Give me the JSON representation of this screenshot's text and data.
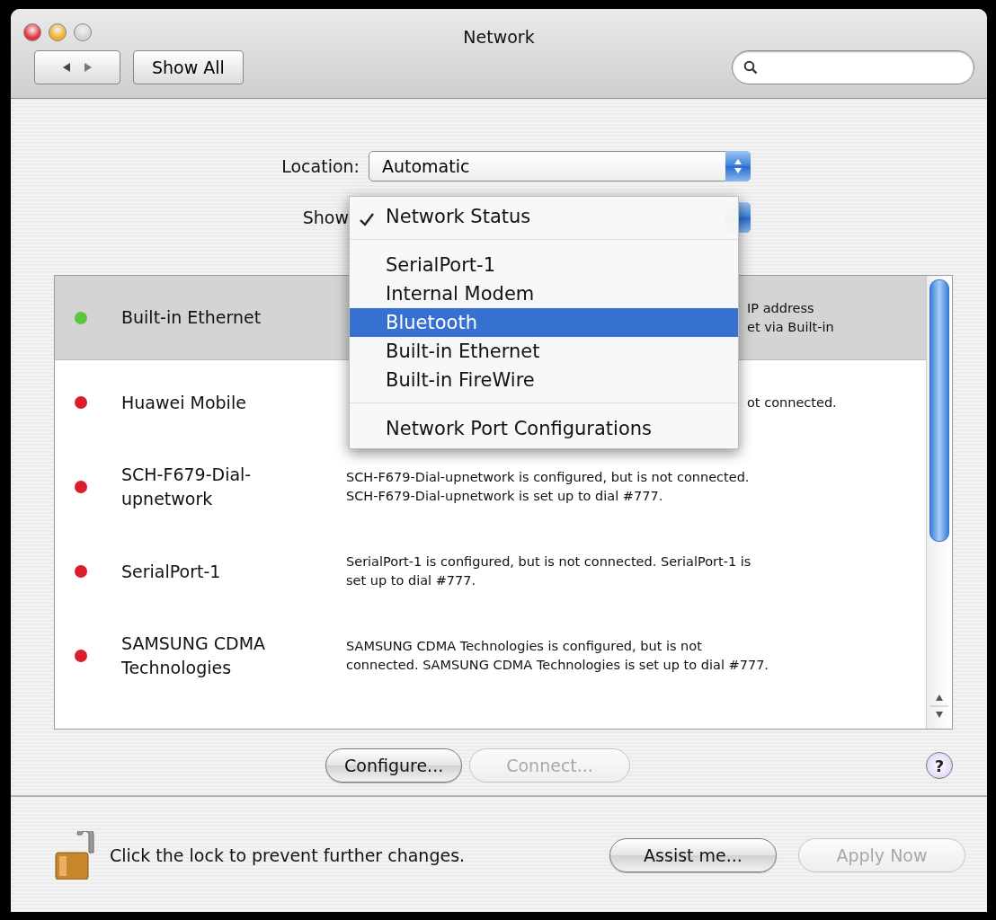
{
  "window": {
    "title": "Network"
  },
  "toolbar": {
    "show_all": "Show All"
  },
  "location": {
    "label": "Location:",
    "value": "Automatic"
  },
  "show": {
    "label": "Show",
    "menu": [
      {
        "kind": "item",
        "label": "Network Status",
        "checked": true,
        "selected": false
      },
      {
        "kind": "separator"
      },
      {
        "kind": "item",
        "label": "SerialPort-1",
        "checked": false,
        "selected": false
      },
      {
        "kind": "item",
        "label": "Internal Modem",
        "checked": false,
        "selected": false
      },
      {
        "kind": "item",
        "label": "Bluetooth",
        "checked": false,
        "selected": true
      },
      {
        "kind": "item",
        "label": "Built-in Ethernet",
        "checked": false,
        "selected": false
      },
      {
        "kind": "item",
        "label": "Built-in FireWire",
        "checked": false,
        "selected": false
      },
      {
        "kind": "separator"
      },
      {
        "kind": "item",
        "label": "Network Port Configurations",
        "checked": false,
        "selected": false
      }
    ]
  },
  "services": [
    {
      "name": "Built-in Ethernet",
      "color": "#5ec63c",
      "selected": true,
      "kind": "covered",
      "description": [
        "IP address",
        "et via Built-in"
      ]
    },
    {
      "name": "Huawei Mobile",
      "color": "#d81f2b",
      "selected": false,
      "kind": "covered",
      "description": [
        "ot connected."
      ]
    },
    {
      "name": "SCH-F679-Dial-upnetwork",
      "color": "#d81f2b",
      "selected": false,
      "kind": "full",
      "description": [
        "SCH-F679-Dial-upnetwork is configured, but is not connected.",
        "SCH-F679-Dial-upnetwork is set up to dial #777."
      ]
    },
    {
      "name": "SerialPort-1",
      "color": "#d81f2b",
      "selected": false,
      "kind": "full",
      "description": [
        "SerialPort-1 is configured, but is not connected. SerialPort-1 is",
        "set up to dial #777."
      ]
    },
    {
      "name": "SAMSUNG CDMA Technologies",
      "color": "#d81f2b",
      "selected": false,
      "kind": "full",
      "description": [
        "SAMSUNG CDMA Technologies is configured, but is not",
        "connected. SAMSUNG CDMA Technologies is set up to dial #777."
      ]
    }
  ],
  "actions": [
    {
      "label": "Configure...",
      "disabled": false
    },
    {
      "label": "Connect...",
      "disabled": true
    }
  ],
  "help": "?",
  "lock_text": "Click the lock to prevent further changes.",
  "footer_buttons": [
    {
      "label": "Assist me...",
      "disabled": false
    },
    {
      "label": "Apply Now",
      "disabled": true
    }
  ]
}
